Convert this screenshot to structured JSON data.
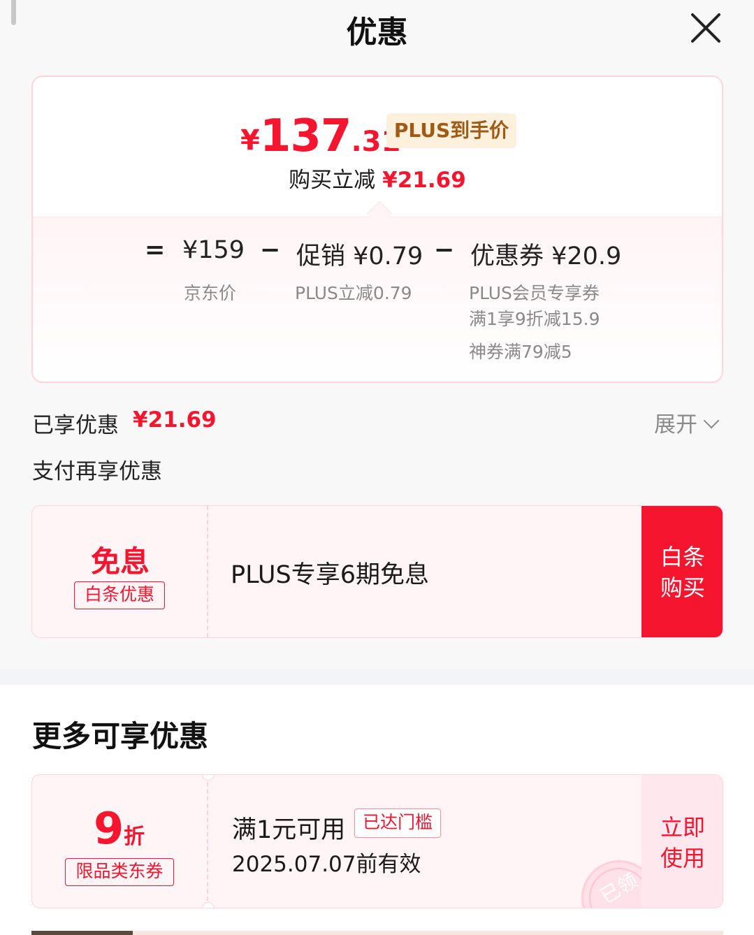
{
  "header": {
    "title": "优惠",
    "close_icon": "close-icon"
  },
  "price_card": {
    "final_price": {
      "currency": "¥",
      "integer": "137",
      "decimal": ".31"
    },
    "plus_tag": "PLUS到手价",
    "instant_label": "购买立减",
    "instant_amount": "¥21.69",
    "breakdown": {
      "equals": "=",
      "jd_price": "¥159",
      "jd_price_label": "京东价",
      "minus1": "−",
      "promo": "促销 ¥0.79",
      "promo_label": "PLUS立减0.79",
      "minus2": "−",
      "coupon": "优惠券 ¥20.9",
      "coupon_label_1": "PLUS会员专享券",
      "coupon_label_2": "满1享9折减15.9",
      "coupon_label_3": "神券满79减5"
    }
  },
  "enjoyed": {
    "label": "已享优惠",
    "amount": "¥21.69",
    "expand": "展开"
  },
  "pay_section": {
    "title": "支付再享优惠",
    "promo": {
      "big": "免息",
      "tag": "白条优惠",
      "text": "PLUS专享6期免息",
      "button_line1": "白条",
      "button_line2": "购买"
    }
  },
  "more_section": {
    "title": "更多可享优惠",
    "coupons": [
      {
        "discount_num": "9",
        "discount_unit": "折",
        "tag": "限品类东券",
        "condition": "满1元可用",
        "badge": "已达门槛",
        "valid": "2025.07.07前有效",
        "action_line1": "立即",
        "action_line2": "使用",
        "stamp": "已领"
      }
    ]
  },
  "colors": {
    "accent": "#f5152e",
    "plus_gold": "#a05a14",
    "muted": "#8a8a8a"
  }
}
